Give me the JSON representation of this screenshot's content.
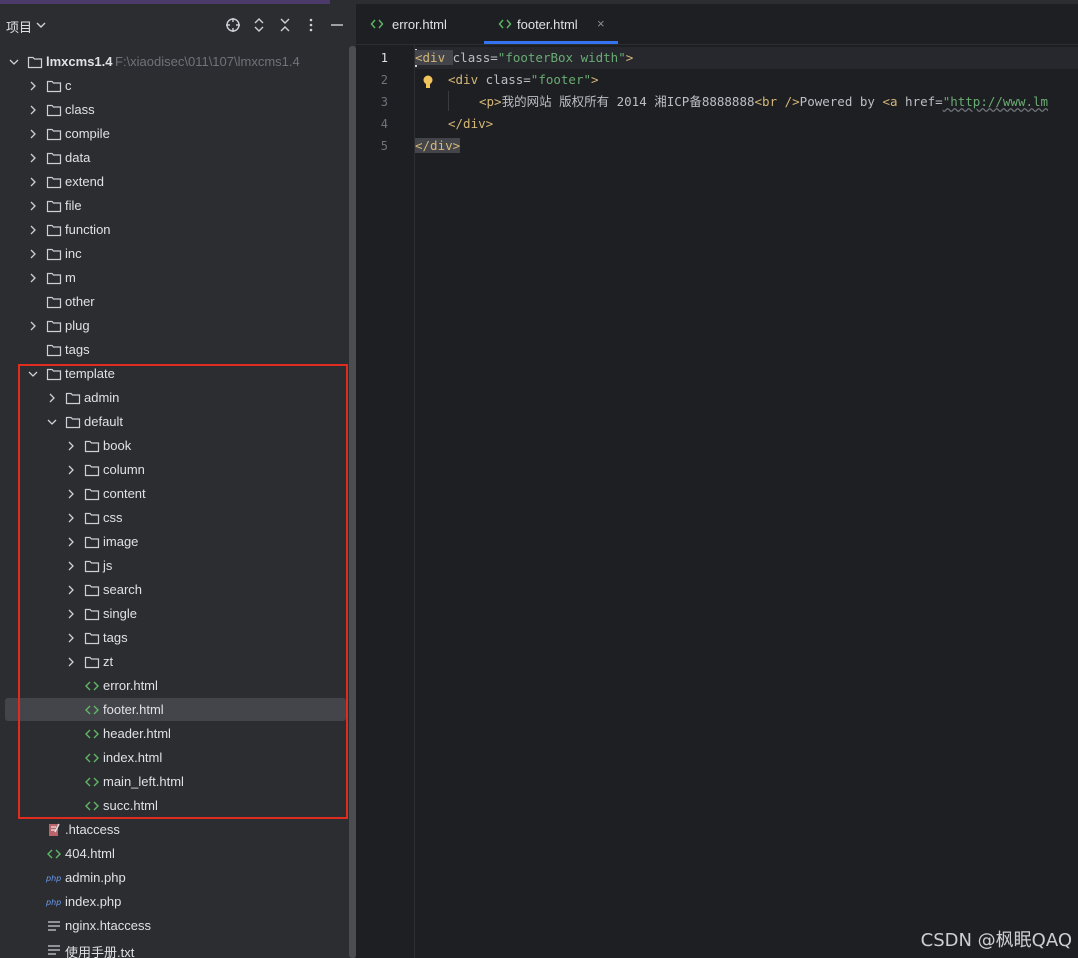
{
  "panel": {
    "title": "项目",
    "icons": [
      "crosshair-icon",
      "expand-all-icon",
      "collapse-all-icon",
      "more-icon",
      "minimize-icon"
    ]
  },
  "tree": {
    "root": {
      "label": "lmxcms1.4",
      "path": "F:\\xiaodisec\\011\\107\\lmxcms1.4"
    },
    "items": [
      {
        "label": "c"
      },
      {
        "label": "class"
      },
      {
        "label": "compile"
      },
      {
        "label": "data"
      },
      {
        "label": "extend"
      },
      {
        "label": "file"
      },
      {
        "label": "function"
      },
      {
        "label": "inc"
      },
      {
        "label": "m"
      },
      {
        "label": "other"
      },
      {
        "label": "plug"
      },
      {
        "label": "tags"
      },
      {
        "label": "template"
      },
      {
        "label": "admin"
      },
      {
        "label": "default"
      },
      {
        "label": "book"
      },
      {
        "label": "column"
      },
      {
        "label": "content"
      },
      {
        "label": "css"
      },
      {
        "label": "image"
      },
      {
        "label": "js"
      },
      {
        "label": "search"
      },
      {
        "label": "single"
      },
      {
        "label": "tags"
      },
      {
        "label": "zt"
      },
      {
        "label": "error.html"
      },
      {
        "label": "footer.html"
      },
      {
        "label": "header.html"
      },
      {
        "label": "index.html"
      },
      {
        "label": "main_left.html"
      },
      {
        "label": "succ.html"
      },
      {
        "label": ".htaccess"
      },
      {
        "label": "404.html"
      },
      {
        "label": "admin.php"
      },
      {
        "label": "index.php"
      },
      {
        "label": "nginx.htaccess"
      },
      {
        "label": "使用手册.txt"
      }
    ]
  },
  "tabs": [
    {
      "label": "error.html",
      "active": false
    },
    {
      "label": "footer.html",
      "active": true
    }
  ],
  "editor": {
    "line_numbers": [
      "1",
      "2",
      "3",
      "4",
      "5"
    ],
    "lines": {
      "l1": {
        "open": "<div ",
        "attr": "class=",
        "val": "\"footerBox width\"",
        "close": ">"
      },
      "l2": {
        "open": "<div ",
        "attr": "class=",
        "val": "\"footer\"",
        "close": ">"
      },
      "l3": {
        "p": "<p>",
        "text": "我的网站 版权所有 2014 湘ICP备8888888",
        "br": "<br />",
        "text2": "Powered by ",
        "a": "<a ",
        "href": "href=",
        "url": "\"http://www.lm"
      },
      "l4": {
        "close": "</div>"
      },
      "l5": {
        "close": "</div>"
      }
    }
  },
  "watermark": "CSDN @枫眠QAQ",
  "colors": {
    "highlight_box": "#e02b1f",
    "active_tab_underline": "#3574f0",
    "html_file_icon": "#5fb865",
    "folder_icon": "#ced0d6"
  }
}
